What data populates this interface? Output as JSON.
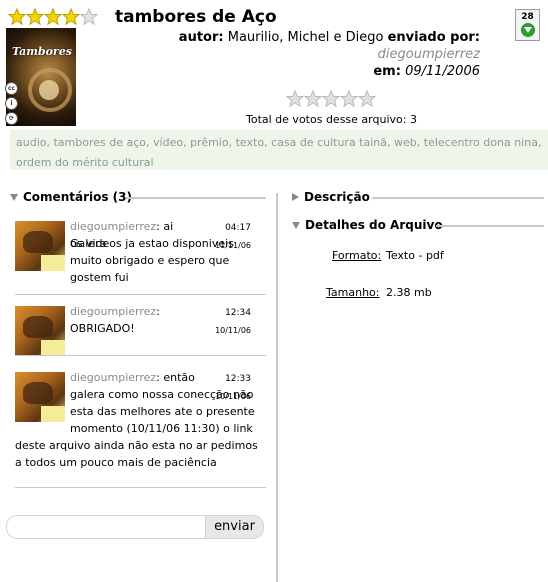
{
  "file": {
    "title": "tambores de Aço",
    "rating_stars": 4,
    "rating_max": 5,
    "download_count": "28",
    "author_label": "autor:",
    "author_value": "Maurilio, Michel e Diego",
    "sent_by_label": "enviado por:",
    "sent_by_value": "diegoumpierrez",
    "date_label": "em:",
    "date_value": "09/11/2006",
    "cover_text": "Tambores de Aço",
    "vote_stars": 0,
    "votes_text": "Total de votos desse arquivo: 3"
  },
  "tags": [
    "audio",
    "tambores de aço",
    "vídeo",
    "prêmio",
    "texto",
    "casa de cultura tainã",
    "web",
    "telecentro dona nina",
    "ordem do mérito cultural"
  ],
  "comments_section": {
    "heading": "Comentários (3)",
    "comments": [
      {
        "user": "diegoumpierrez",
        "text_first": ": ai Galera",
        "text_rest": "os videos ja estao disponiveis muito obrigado e espero que gostem fui",
        "time": "04:17",
        "date": "11/11/06"
      },
      {
        "user": "diegoumpierrez",
        "text_first": ":",
        "text_rest": "OBRIGADO!",
        "time": "12:34",
        "date": "10/11/06"
      },
      {
        "user": "diegoumpierrez",
        "text_first": ": então",
        "text_rest": "galera como nossa conecção não esta das melhores ate o presente momento (10/11/06 11:30) o link deste arquivo ainda não esta no ar pedimos a todos um pouco mais de paciência",
        "time": "12:33",
        "date": "10/11/06"
      }
    ],
    "send_label": "enviar",
    "input_value": ""
  },
  "description_section": {
    "heading": "Descrição"
  },
  "details_section": {
    "heading": "Detalhes do Arquivo",
    "format_label": "Formato:",
    "format_value": "Texto - pdf",
    "size_label": "Tamanho:",
    "size_value": "2.38 mb"
  },
  "colors": {
    "accent_green": "#2f9b2f",
    "tag_bg": "#eef6ea",
    "star_on": "#f2d400",
    "star_off": "#e2e2e2"
  },
  "icons": [
    "star-icon",
    "download-icon",
    "cc-license-icon"
  ]
}
